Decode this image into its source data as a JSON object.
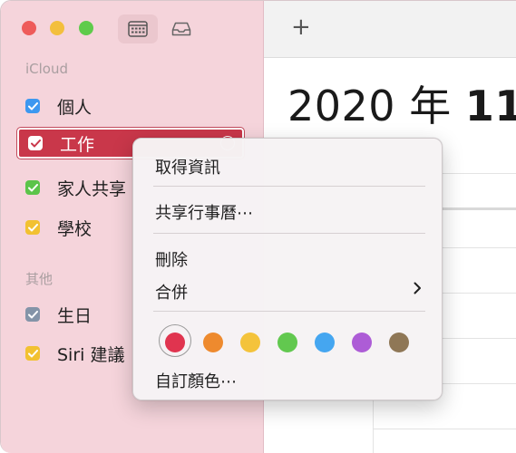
{
  "sidebar": {
    "sections": [
      {
        "label": "iCloud",
        "calendars": [
          {
            "label": "個人",
            "color": "#3d98f0",
            "checked": true
          },
          {
            "label": "工作",
            "color": "#e0344f",
            "checked": true,
            "selected": true
          },
          {
            "label": "家人共享",
            "color": "#5cc44a",
            "checked": true
          },
          {
            "label": "學校",
            "color": "#f2c131",
            "checked": true
          }
        ]
      },
      {
        "label": "其他",
        "calendars": [
          {
            "label": "生日",
            "color": "#8494a8",
            "checked": true
          },
          {
            "label": "Siri 建議",
            "color": "#f2c131",
            "checked": true
          }
        ]
      }
    ]
  },
  "toolbar": {
    "calendar_button_icon": "calendar-grid-icon",
    "inbox_button_icon": "inbox-tray-icon",
    "add_label": "+"
  },
  "main": {
    "month_title_year": "2020 年",
    "month_title_month": "11"
  },
  "context_menu": {
    "get_info": "取得資訊",
    "share_calendar": "共享行事曆⋯",
    "delete": "刪除",
    "merge": "合併",
    "custom_color": "自訂顏色⋯",
    "swatches": [
      {
        "name": "red",
        "color": "#e0344f",
        "selected": true
      },
      {
        "name": "orange",
        "color": "#ee8a2e"
      },
      {
        "name": "yellow",
        "color": "#f4c33b"
      },
      {
        "name": "green",
        "color": "#62c84f"
      },
      {
        "name": "blue",
        "color": "#45a6f0"
      },
      {
        "name": "purple",
        "color": "#ad5cd6"
      },
      {
        "name": "brown",
        "color": "#8f7756"
      }
    ]
  }
}
